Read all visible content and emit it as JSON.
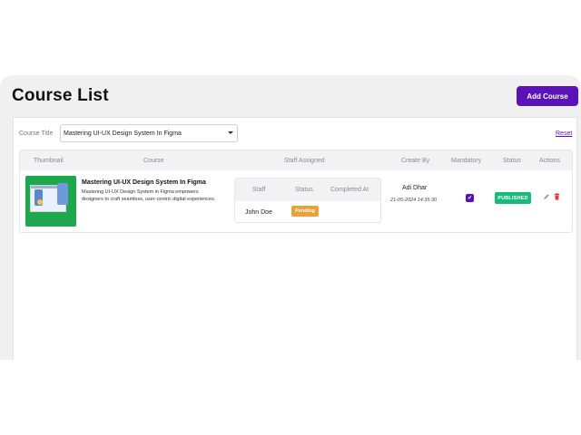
{
  "page": {
    "title": "Course List"
  },
  "header": {
    "add_button_label": "Add Course",
    "accent_color": "#5b12b8"
  },
  "filter": {
    "label": "Course Title",
    "selected_value": "Mastering UI-UX Design System In Figma",
    "reset_label": "Reset"
  },
  "table": {
    "columns": [
      "Thumbnail",
      "Course",
      "Staff Assigned",
      "Create By",
      "Mandatory",
      "Status",
      "Actions"
    ],
    "rows": [
      {
        "course_title": "Mastering UI-UX Design System In Figma",
        "course_description": "Mastering UI-UX Design System in Figma empowers designers to craft seamless, user-centric digital experiences.",
        "staff_table": {
          "columns": [
            "Staff",
            "Status",
            "Completed At"
          ],
          "rows": [
            {
              "staff": "John Doe",
              "status": "Pending",
              "completed_at": ""
            }
          ]
        },
        "created_by": "Adi Dhar",
        "created_at": "21-05-2024 14:35:30",
        "mandatory": true,
        "status": "PUBLISHED",
        "actions": [
          "edit-icon",
          "delete-icon"
        ]
      }
    ]
  },
  "colors": {
    "published": "#19b97c",
    "pending": "#eaa13a",
    "delete": "#e23b3b"
  }
}
